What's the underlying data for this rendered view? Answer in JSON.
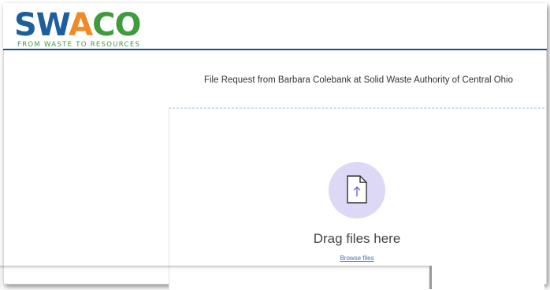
{
  "brand": {
    "logo_letters": [
      "SW",
      "A",
      "CO"
    ],
    "logo_tagline": "FROM WASTE TO RESOURCES",
    "primary_color": "#1d5e9c",
    "accent_orange": "#f08a24",
    "accent_green": "#3f9b3c"
  },
  "request": {
    "title": "File Request from Barbara Colebank at Solid Waste Authority of Central Ohio"
  },
  "upload": {
    "icon": "file-upload-icon",
    "drag_text": "Drag files here",
    "browse_label": "Browse files"
  }
}
